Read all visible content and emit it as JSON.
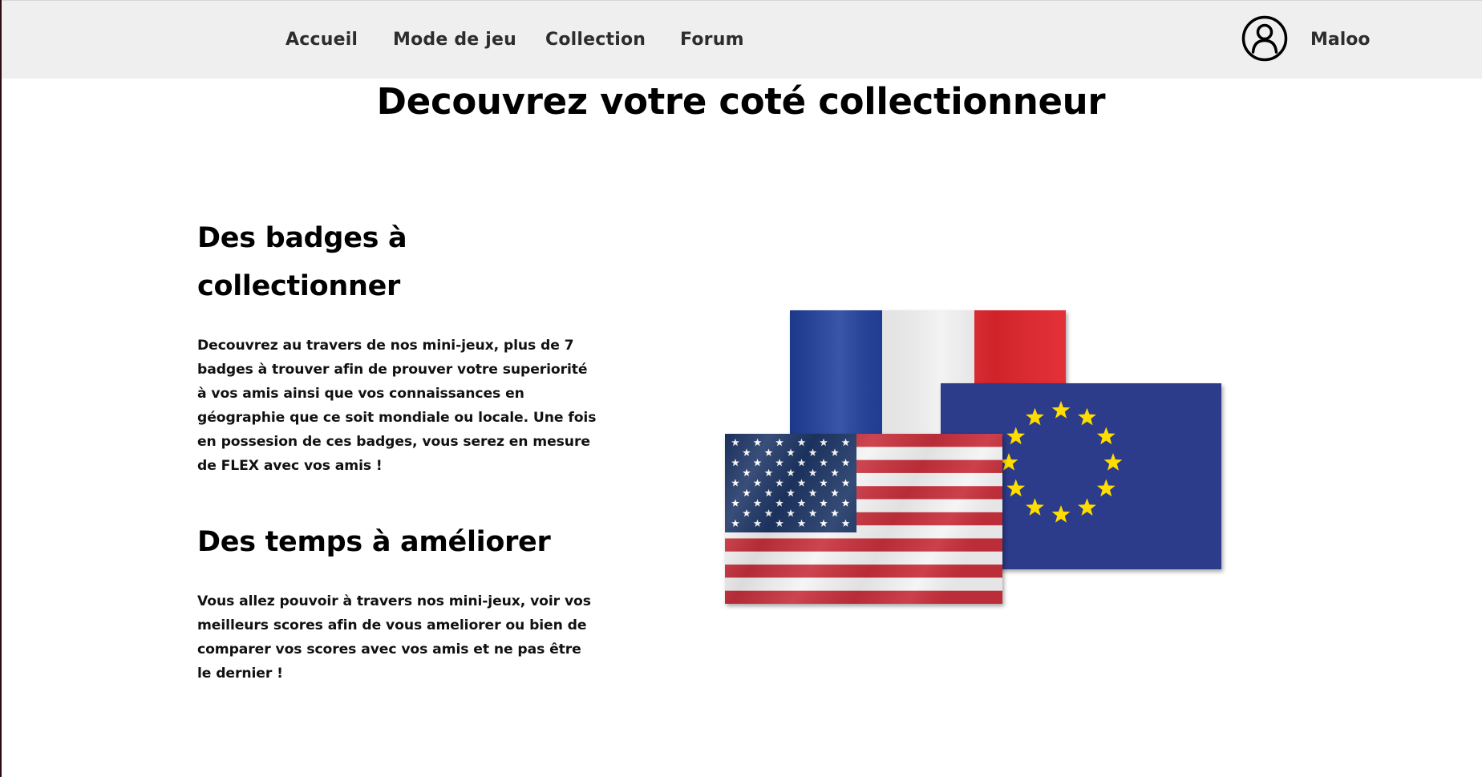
{
  "nav": {
    "items": [
      {
        "label": "Accueil"
      },
      {
        "label": "Mode de jeu"
      },
      {
        "label": "Collection"
      },
      {
        "label": "Forum"
      }
    ],
    "user": {
      "name": "Maloo",
      "icon": "user-circle-icon"
    }
  },
  "page": {
    "title": "Decouvrez votre coté collectionneur"
  },
  "sections": [
    {
      "title": "Des badges à collectionner",
      "text": "Decouvrez au travers de nos mini-jeux, plus de 7 badges à trouver afin de prouver votre superiorité à vos amis ainsi que vos connaissances en géographie que ce soit mondiale ou locale. Une fois en possesion de ces badges, vous serez en mesure de FLEX avec vos amis !"
    },
    {
      "title": "Des temps à améliorer",
      "text": "Vous allez pouvoir à travers nos mini-jeux, voir vos meilleurs scores afin de vous ameliorer ou bien de comparer vos scores avec vos amis et ne pas être le dernier !"
    }
  ],
  "images": {
    "flags": [
      "france-flag",
      "european-union-flag",
      "usa-flag"
    ]
  },
  "colors": {
    "navbar_bg": "#efefef",
    "nav_text": "#2d2d2d",
    "france_blue": "#1f3f9b",
    "france_red": "#e1262d",
    "eu_blue": "#2c3b8a",
    "eu_star": "#ffdd00",
    "us_red": "#c7303c",
    "us_blue": "#1e3767"
  }
}
